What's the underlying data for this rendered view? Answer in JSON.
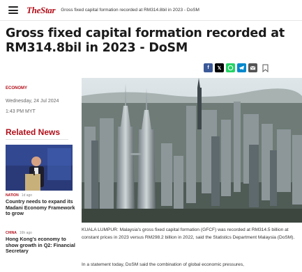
{
  "header": {
    "menu_icon": "hamburger-icon",
    "logo_text": "TheStar",
    "title": "Gross fixed capital formation recorded at RM314.8bil in 2023 - DoSM"
  },
  "article": {
    "headline": "Gross fixed capital formation recorded at RM314.8bil in 2023 - DoSM",
    "section": "ECONOMY",
    "date": "Wednesday, 24 Jul 2024",
    "time": "1:43 PM MYT",
    "paragraph1": "KUALA LUMPUR: Malaysia's gross fixed capital formation (GFCF) was recorded at RM314.5 billion at constant prices in 2023 versus RM298.2 billion in 2022, said the Statistics Department Malaysia (DoSM).",
    "paragraph2": "In a statement today, DoSM said the combination of global economic pressures,"
  },
  "share": {
    "icons": [
      "facebook-icon",
      "x-icon",
      "whatsapp-icon",
      "telegram-icon",
      "email-icon",
      "bookmark-icon"
    ],
    "colors": [
      "#3b5998",
      "#000000",
      "#25d366",
      "#0088cc",
      "#555555"
    ]
  },
  "related": {
    "heading": "Related News",
    "items": [
      {
        "category": "NATION",
        "age": "1d ago",
        "title": "Country needs to expand its Madani Economy Framework to grow"
      },
      {
        "category": "CHINA",
        "age": "16h ago",
        "title": "Hong Kong's economy to show growth in Q2: Financial Secretary"
      }
    ]
  },
  "colors": {
    "brand": "#b10f1a"
  }
}
